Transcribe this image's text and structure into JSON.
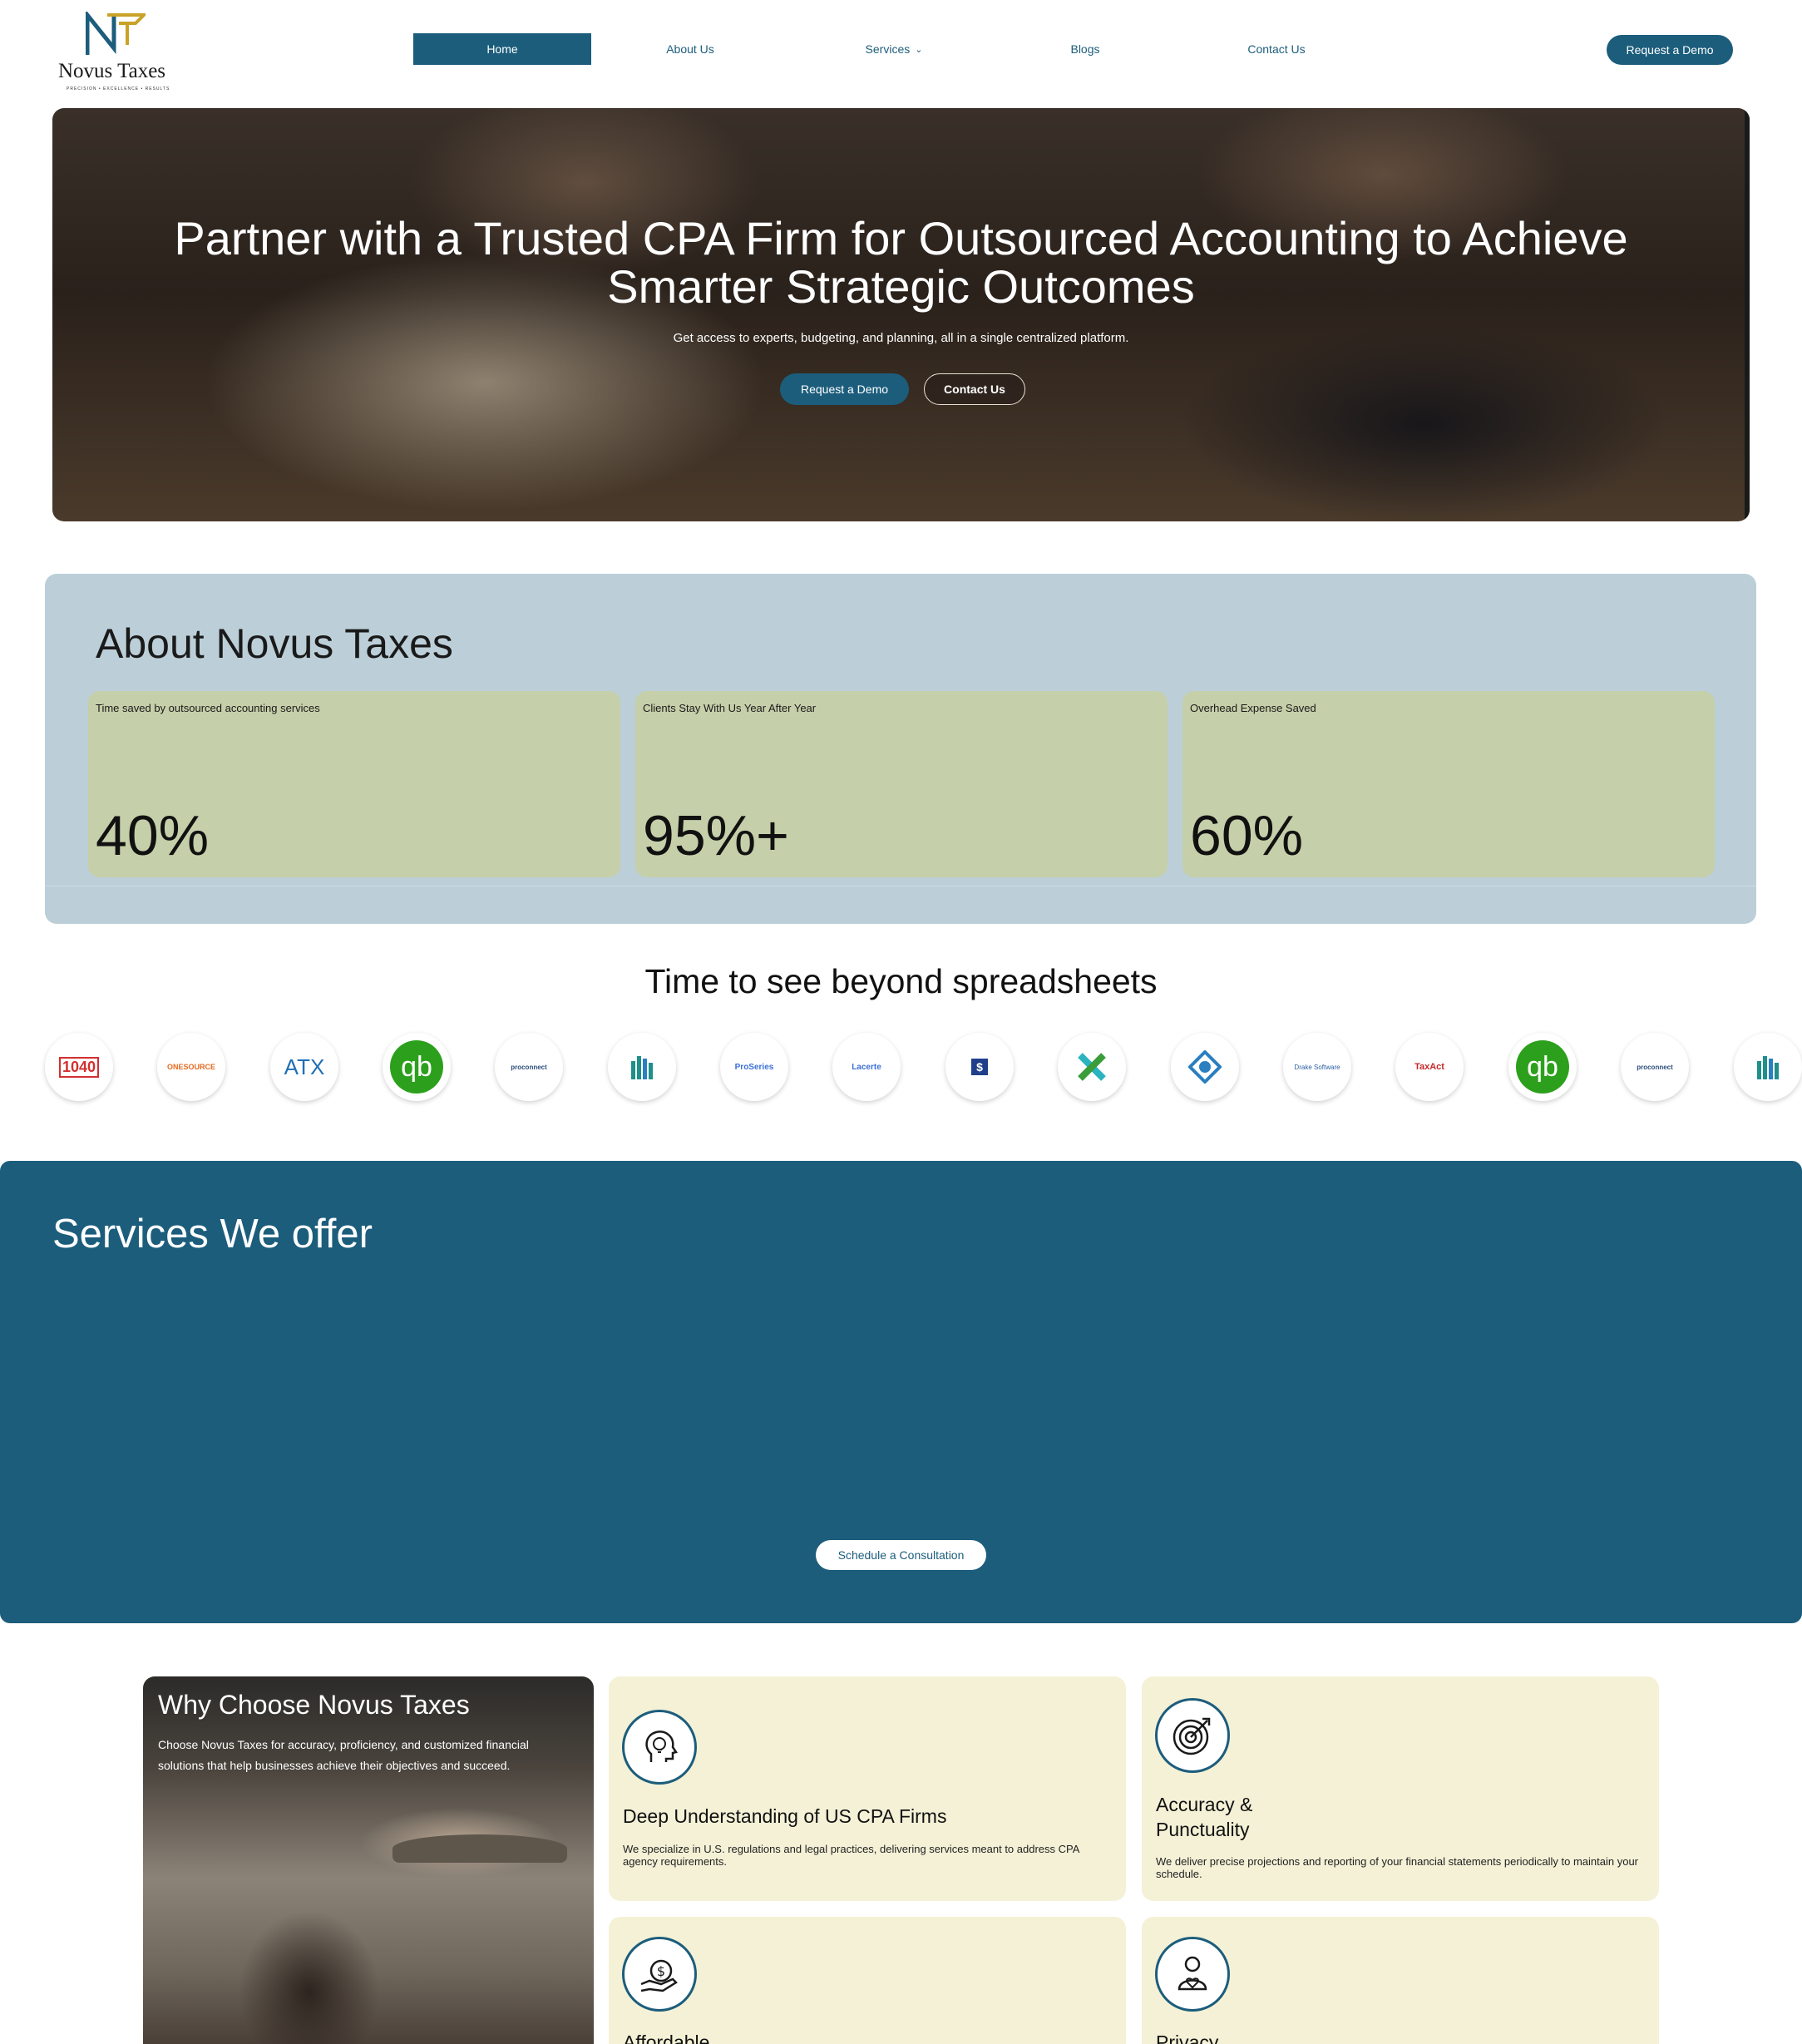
{
  "colors": {
    "primary": "#1c5d7c",
    "about_bg": "#bccfd8",
    "stat_bg": "#c5cfa9",
    "feature_bg": "#f4f1d6"
  },
  "brand": {
    "name": "Novus Taxes",
    "tagline": "PRECISION • EXCELLENCE • RESULTS",
    "logo_letters": "NT"
  },
  "nav": {
    "items": [
      {
        "label": "Home",
        "active": true
      },
      {
        "label": "About Us"
      },
      {
        "label": "Services",
        "icon": "chevron-down-icon"
      },
      {
        "label": "Blogs"
      },
      {
        "label": "Contact Us"
      }
    ],
    "cta": "Request a Demo"
  },
  "hero": {
    "title_line1": "Partner with a Trusted CPA Firm for Outsourced Accounting to Achieve",
    "title_line2": "Smarter Strategic Outcomes",
    "subtitle": "Get access to experts, budgeting, and planning, all in a single centralized platform.",
    "primary_button": "Request a Demo",
    "secondary_button": "Contact Us"
  },
  "about": {
    "title": "About Novus Taxes",
    "stats": [
      {
        "label": "Time saved by outsourced accounting services",
        "value": "40%"
      },
      {
        "label": "Clients Stay With Us Year After Year",
        "value": "95%+"
      },
      {
        "label": "Overhead Expense Saved",
        "value": "60%"
      }
    ]
  },
  "software": {
    "title": "Time to see beyond spreadsheets",
    "logos": [
      {
        "icon": "form-1040-icon",
        "text": "1040",
        "color": "#d32f2f"
      },
      {
        "icon": "onesource-icon",
        "text": "ONESOURCE",
        "color": "#e66a1f"
      },
      {
        "icon": "atx-icon",
        "text": "ATX",
        "color": "#1f6fb5"
      },
      {
        "icon": "quickbooks-icon",
        "text": "qb",
        "color": "#2ca01c"
      },
      {
        "icon": "proconnect-icon",
        "text": "proconnect",
        "color": "#2a4d7a"
      },
      {
        "icon": "building-chart-icon",
        "text": "",
        "color": "#1f8f8a"
      },
      {
        "icon": "proseries-icon",
        "text": "ProSeries",
        "color": "#3b6fd8"
      },
      {
        "icon": "lacerte-icon",
        "text": "Lacerte",
        "color": "#3b6fd8"
      },
      {
        "icon": "ultratax-icon",
        "text": "$",
        "color": "#1f3f8a"
      },
      {
        "icon": "xero-cross-icon",
        "text": "",
        "color": "#2bb3c0"
      },
      {
        "icon": "compass-icon",
        "text": "",
        "color": "#2a7fc0"
      },
      {
        "icon": "drake-software-icon",
        "text": "Drake Software",
        "color": "#2a5fa0"
      },
      {
        "icon": "taxact-icon",
        "text": "TaxAct",
        "color": "#c62828"
      },
      {
        "icon": "quickbooks-icon",
        "text": "qb",
        "color": "#2ca01c"
      },
      {
        "icon": "proconnect-icon",
        "text": "proconnect",
        "color": "#2a4d7a"
      },
      {
        "icon": "building-chart-icon",
        "text": "",
        "color": "#1f8f8a"
      }
    ]
  },
  "services": {
    "title": "Services We offer",
    "button": "Schedule a Consultation"
  },
  "why": {
    "title": "Why Choose Novus Taxes",
    "text": "Choose Novus Taxes for accuracy, proficiency, and customized financial solutions that help businesses achieve their objectives and succeed.",
    "features": [
      {
        "icon": "brain-bulb-icon",
        "title": "Deep Understanding of US CPA Firms",
        "text": "We specialize in U.S. regulations and legal practices, delivering services meant to address CPA agency requirements."
      },
      {
        "icon": "target-icon",
        "title_line1": "Accuracy &",
        "title_line2": "Punctuality",
        "text": "We deliver precise projections and reporting of your financial statements periodically to maintain your schedule."
      },
      {
        "icon": "dollar-hand-icon",
        "title": "Affordable"
      },
      {
        "icon": "privacy-heart-icon",
        "title": "Privacy"
      }
    ]
  }
}
